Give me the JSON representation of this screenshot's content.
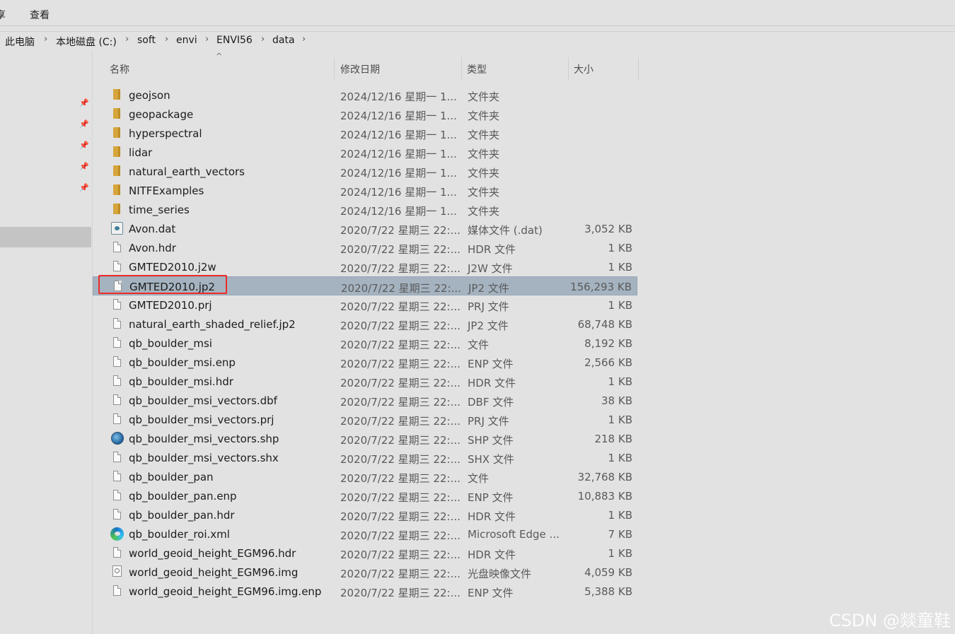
{
  "ribbon": {
    "tabs": [
      "享",
      "查看"
    ]
  },
  "address": {
    "crumbs": [
      "此电脑",
      "本地磁盘 (C:)",
      "soft",
      "envi",
      "ENVI56",
      "data"
    ]
  },
  "columns": {
    "name": "名称",
    "date": "修改日期",
    "type": "类型",
    "size": "大小"
  },
  "files": [
    {
      "name": "geojson",
      "date": "2024/12/16 星期一 1...",
      "type": "文件夹",
      "size": "",
      "icon": "folder-icon"
    },
    {
      "name": "geopackage",
      "date": "2024/12/16 星期一 1...",
      "type": "文件夹",
      "size": "",
      "icon": "folder-icon"
    },
    {
      "name": "hyperspectral",
      "date": "2024/12/16 星期一 1...",
      "type": "文件夹",
      "size": "",
      "icon": "folder-icon"
    },
    {
      "name": "lidar",
      "date": "2024/12/16 星期一 1...",
      "type": "文件夹",
      "size": "",
      "icon": "folder-icon"
    },
    {
      "name": "natural_earth_vectors",
      "date": "2024/12/16 星期一 1...",
      "type": "文件夹",
      "size": "",
      "icon": "folder-icon"
    },
    {
      "name": "NITFExamples",
      "date": "2024/12/16 星期一 1...",
      "type": "文件夹",
      "size": "",
      "icon": "folder-icon"
    },
    {
      "name": "time_series",
      "date": "2024/12/16 星期一 1...",
      "type": "文件夹",
      "size": "",
      "icon": "folder-icon"
    },
    {
      "name": "Avon.dat",
      "date": "2020/7/22 星期三 22:...",
      "type": "媒体文件 (.dat)",
      "size": "3,052 KB",
      "icon": "media-file-icon"
    },
    {
      "name": "Avon.hdr",
      "date": "2020/7/22 星期三 22:...",
      "type": "HDR 文件",
      "size": "1 KB",
      "icon": "file-icon"
    },
    {
      "name": "GMTED2010.j2w",
      "date": "2020/7/22 星期三 22:...",
      "type": "J2W 文件",
      "size": "1 KB",
      "icon": "file-icon"
    },
    {
      "name": "GMTED2010.jp2",
      "date": "2020/7/22 星期三 22:...",
      "type": "JP2 文件",
      "size": "156,293 KB",
      "icon": "file-icon",
      "selected": true
    },
    {
      "name": "GMTED2010.prj",
      "date": "2020/7/22 星期三 22:...",
      "type": "PRJ 文件",
      "size": "1 KB",
      "icon": "file-icon"
    },
    {
      "name": "natural_earth_shaded_relief.jp2",
      "date": "2020/7/22 星期三 22:...",
      "type": "JP2 文件",
      "size": "68,748 KB",
      "icon": "file-icon"
    },
    {
      "name": "qb_boulder_msi",
      "date": "2020/7/22 星期三 22:...",
      "type": "文件",
      "size": "8,192 KB",
      "icon": "file-icon"
    },
    {
      "name": "qb_boulder_msi.enp",
      "date": "2020/7/22 星期三 22:...",
      "type": "ENP 文件",
      "size": "2,566 KB",
      "icon": "file-icon"
    },
    {
      "name": "qb_boulder_msi.hdr",
      "date": "2020/7/22 星期三 22:...",
      "type": "HDR 文件",
      "size": "1 KB",
      "icon": "file-icon"
    },
    {
      "name": "qb_boulder_msi_vectors.dbf",
      "date": "2020/7/22 星期三 22:...",
      "type": "DBF 文件",
      "size": "38 KB",
      "icon": "file-icon"
    },
    {
      "name": "qb_boulder_msi_vectors.prj",
      "date": "2020/7/22 星期三 22:...",
      "type": "PRJ 文件",
      "size": "1 KB",
      "icon": "file-icon"
    },
    {
      "name": "qb_boulder_msi_vectors.shp",
      "date": "2020/7/22 星期三 22:...",
      "type": "SHP 文件",
      "size": "218 KB",
      "icon": "globe-icon"
    },
    {
      "name": "qb_boulder_msi_vectors.shx",
      "date": "2020/7/22 星期三 22:...",
      "type": "SHX 文件",
      "size": "1 KB",
      "icon": "file-icon"
    },
    {
      "name": "qb_boulder_pan",
      "date": "2020/7/22 星期三 22:...",
      "type": "文件",
      "size": "32,768 KB",
      "icon": "file-icon"
    },
    {
      "name": "qb_boulder_pan.enp",
      "date": "2020/7/22 星期三 22:...",
      "type": "ENP 文件",
      "size": "10,883 KB",
      "icon": "file-icon"
    },
    {
      "name": "qb_boulder_pan.hdr",
      "date": "2020/7/22 星期三 22:...",
      "type": "HDR 文件",
      "size": "1 KB",
      "icon": "file-icon"
    },
    {
      "name": "qb_boulder_roi.xml",
      "date": "2020/7/22 星期三 22:...",
      "type": "Microsoft Edge ...",
      "size": "7 KB",
      "icon": "edge-icon"
    },
    {
      "name": "world_geoid_height_EGM96.hdr",
      "date": "2020/7/22 星期三 22:...",
      "type": "HDR 文件",
      "size": "1 KB",
      "icon": "file-icon"
    },
    {
      "name": "world_geoid_height_EGM96.img",
      "date": "2020/7/22 星期三 22:...",
      "type": "光盘映像文件",
      "size": "4,059 KB",
      "icon": "disc-image-icon"
    },
    {
      "name": "world_geoid_height_EGM96.img.enp",
      "date": "2020/7/22 星期三 22:...",
      "type": "ENP 文件",
      "size": "5,388 KB",
      "icon": "file-icon"
    }
  ],
  "watermark": "CSDN @燚童鞋",
  "colors": {
    "selection": "#a5b3c0",
    "annotation": "#ee2a2a",
    "folder": "#d6a53c"
  }
}
